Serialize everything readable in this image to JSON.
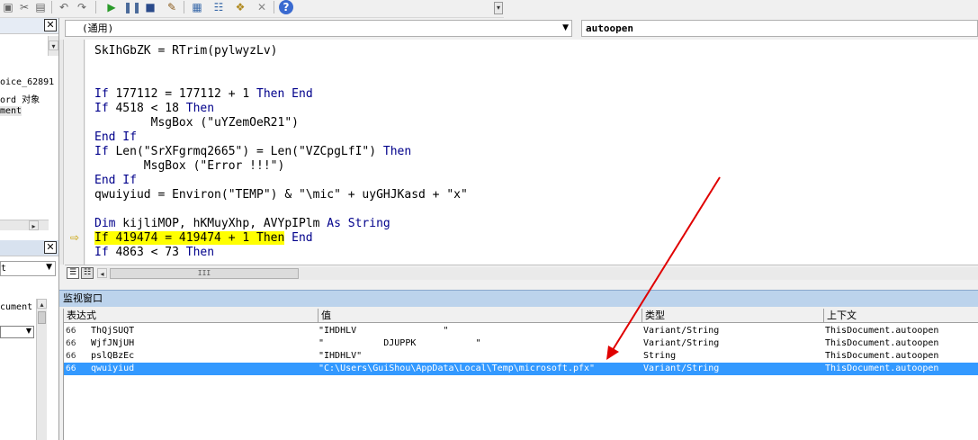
{
  "toolbar": {
    "icons": [
      "undo-icon",
      "redo-icon",
      "run-icon",
      "break-icon",
      "reset-icon",
      "design-mode-icon",
      "project-explorer-icon",
      "properties-icon",
      "object-browser-icon",
      "toolbox-icon",
      "help-icon"
    ]
  },
  "left_panel": {
    "project_lines": [
      "oice_62891",
      "ord 对象",
      "ment"
    ],
    "properties_select": "t",
    "properties_item": "cument"
  },
  "editor": {
    "object_dropdown": "(通用)",
    "procedure_dropdown": "autoopen",
    "lines": [
      {
        "text": "SkIhGbZK = RTrim(pylwyzLv)"
      },
      {
        "text": ""
      },
      {
        "text": ""
      },
      {
        "pre": "",
        "kw1": "If",
        "mid": " 177112 = 177112 + 1 ",
        "kw2": "Then End",
        "post": ""
      },
      {
        "pre": "",
        "kw1": "If",
        "mid": " 4518 < 18 ",
        "kw2": "Then",
        "post": ""
      },
      {
        "text": "        MsgBox (\"uYZemOeR21\")"
      },
      {
        "pre": "",
        "kw1": "End If",
        "mid": "",
        "kw2": "",
        "post": ""
      },
      {
        "pre": "",
        "kw1": "If",
        "mid": " Len(\"SrXFgrmq2665\") = Len(\"VZCpgLfI\") ",
        "kw2": "Then",
        "post": ""
      },
      {
        "text": "       MsgBox (\"Error !!!\")"
      },
      {
        "pre": "",
        "kw1": "End If",
        "mid": "",
        "kw2": "",
        "post": ""
      },
      {
        "text": "qwuiyiud = Environ(\"TEMP\") & \"\\mic\" + uyGHJKasd + \"x\""
      },
      {
        "text": ""
      },
      {
        "pre": "",
        "kw1": "Dim",
        "mid": " kijliMOP, hKMuyXhp, AVYpIPlm ",
        "kw2": "As String",
        "post": ""
      },
      {
        "highlight": "If 419474 = 419474 + 1 Then",
        "kw2": " End"
      },
      {
        "pre": "",
        "kw1": "If",
        "mid": " 4863 < 73 ",
        "kw2": "Then",
        "post": ""
      }
    ],
    "hscroll_thumb": "III"
  },
  "watch_window": {
    "title": "监视窗口",
    "headers": [
      "表达式",
      "值",
      "类型",
      "上下文"
    ],
    "rows": [
      {
        "expr": "ThQjSUQT",
        "value": "\"IHDHLV                \"",
        "type": "Variant/String",
        "context": "ThisDocument.autoopen",
        "selected": false
      },
      {
        "expr": "WjfJNjUH",
        "value": "\"           DJUPPK           \"",
        "type": "Variant/String",
        "context": "ThisDocument.autoopen",
        "selected": false
      },
      {
        "expr": "pslQBzEc",
        "value": "\"IHDHLV\"",
        "type": "String",
        "context": "ThisDocument.autoopen",
        "selected": false
      },
      {
        "expr": "qwuiyiud",
        "value": "\"C:\\Users\\GuiShou\\AppData\\Local\\Temp\\microsoft.pfx\"",
        "type": "Variant/String",
        "context": "ThisDocument.autoopen",
        "selected": true
      }
    ]
  },
  "colors": {
    "keyword": "#00008b",
    "highlight": "#ffff00",
    "selection": "#3399ff",
    "annotation_arrow": "#e00000",
    "watch_title_bg": "#bcd3ec"
  }
}
